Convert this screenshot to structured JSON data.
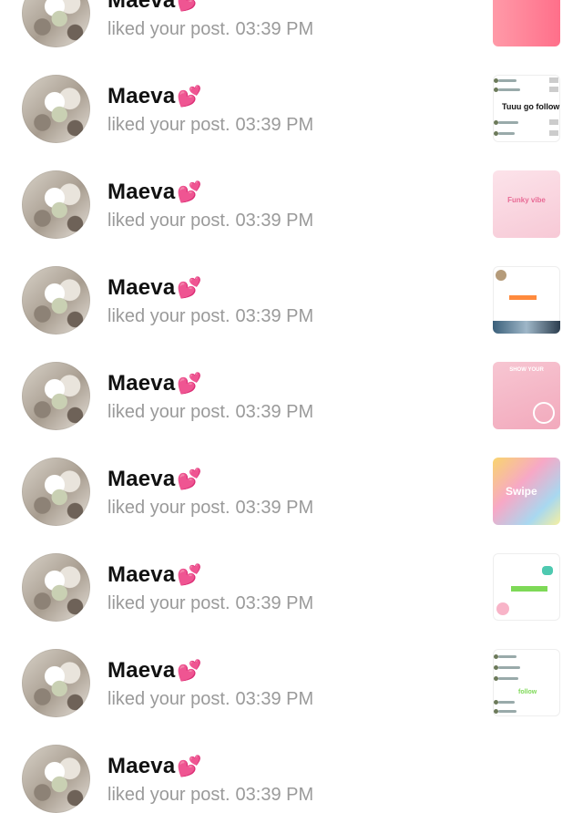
{
  "notifications": [
    {
      "name": "Maeva",
      "emoji": "💕",
      "text": "liked your post.",
      "time": "03:39 PM",
      "thumb": "top",
      "thumb_text": ""
    },
    {
      "name": "Maeva",
      "emoji": "💕",
      "text": "liked your post.",
      "time": "03:39 PM",
      "thumb": "list",
      "thumb_text": "Tuuu go follow"
    },
    {
      "name": "Maeva",
      "emoji": "💕",
      "text": "liked your post.",
      "time": "03:39 PM",
      "thumb": "pink",
      "thumb_text": "Funky vibe"
    },
    {
      "name": "Maeva",
      "emoji": "💕",
      "text": "liked your post.",
      "time": "03:39 PM",
      "thumb": "profile",
      "thumb_text": ""
    },
    {
      "name": "Maeva",
      "emoji": "💕",
      "text": "liked your post.",
      "time": "03:39 PM",
      "thumb": "blush",
      "thumb_text": "SHOW YOUR"
    },
    {
      "name": "Maeva",
      "emoji": "💕",
      "text": "liked your post.",
      "time": "03:39 PM",
      "thumb": "pastel",
      "thumb_text": "Swipe"
    },
    {
      "name": "Maeva",
      "emoji": "💕",
      "text": "liked your post.",
      "time": "03:39 PM",
      "thumb": "profile2",
      "thumb_text": ""
    },
    {
      "name": "Maeva",
      "emoji": "💕",
      "text": "liked your post.",
      "time": "03:39 PM",
      "thumb": "list2",
      "thumb_text": "follow"
    },
    {
      "name": "Maeva",
      "emoji": "💕",
      "text": "liked your post.",
      "time": "03:39 PM",
      "thumb": "none",
      "thumb_text": ""
    }
  ]
}
